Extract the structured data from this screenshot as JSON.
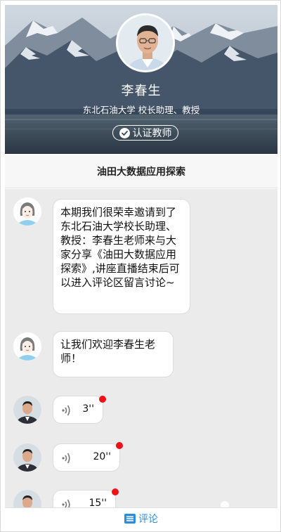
{
  "profile": {
    "name": "李春生",
    "title": "东北石油大学 校长助理、教授",
    "badge_label": "认证教师",
    "badge_icon": "check-circle-icon"
  },
  "topic": {
    "title": "油田大数据应用探索"
  },
  "messages": [
    {
      "type": "text",
      "sender": "host",
      "text": "本期我们很荣幸邀请到了东北石油大学校长助理、教授：李春生老师来与大家分享《油田大数据应用探索》,讲座直播结束后可以进入评论区留言讨论~"
    },
    {
      "type": "text",
      "sender": "host",
      "text": "让我们欢迎李春生老师！"
    },
    {
      "type": "voice",
      "sender": "lecturer",
      "duration": "3''",
      "unread": true
    },
    {
      "type": "voice",
      "sender": "lecturer",
      "duration": "20''",
      "unread": true
    },
    {
      "type": "voice",
      "sender": "lecturer",
      "duration": "15''",
      "unread": true
    }
  ],
  "bottom_bar": {
    "comment_label": "评论",
    "icon": "comment-list-icon"
  },
  "colors": {
    "accent": "#2a8ee0",
    "unread_dot": "#f0101a",
    "chat_bg": "#ebebeb"
  }
}
